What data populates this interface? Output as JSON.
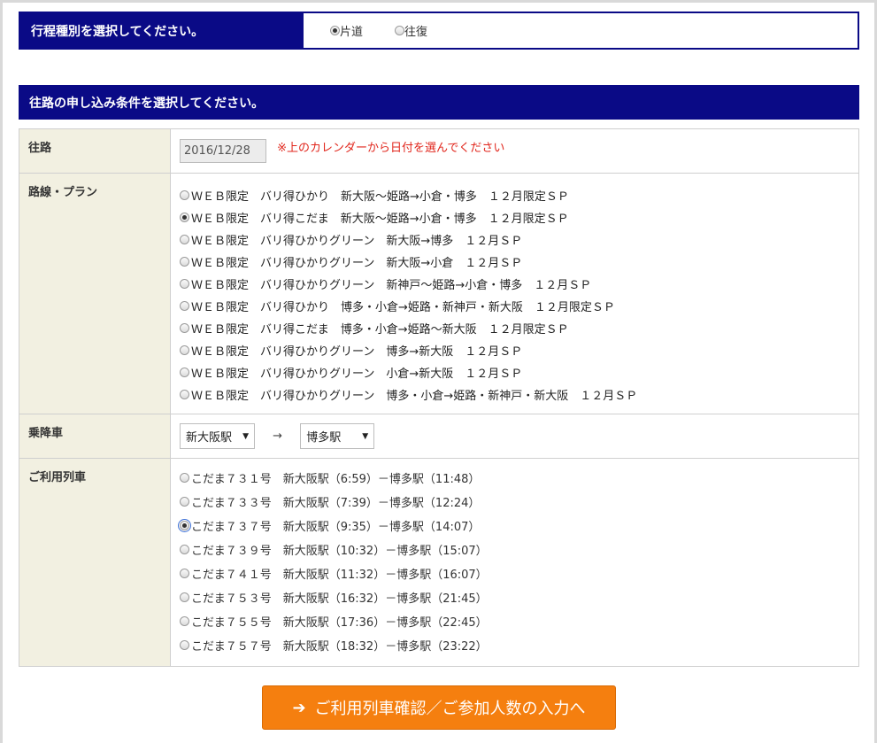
{
  "trip_type": {
    "label": "行程種別を選択してください。",
    "options": [
      {
        "label": "片道",
        "selected": true
      },
      {
        "label": "往復",
        "selected": false
      }
    ]
  },
  "outbound": {
    "header": "往路の申し込み条件を選択してください。",
    "date_label": "往路",
    "date_value": "2016/12/28",
    "date_note": "※上のカレンダーから日付を選んでください",
    "plan_label": "路線・プラン",
    "plans": [
      {
        "label": "ＷＥＢ限定　バリ得ひかり　新大阪～姫路→小倉・博多　１２月限定ＳＰ",
        "selected": false
      },
      {
        "label": "ＷＥＢ限定　バリ得こだま　新大阪～姫路→小倉・博多　１２月限定ＳＰ",
        "selected": true
      },
      {
        "label": "ＷＥＢ限定　バリ得ひかりグリーン　新大阪→博多　１２月ＳＰ",
        "selected": false
      },
      {
        "label": "ＷＥＢ限定　バリ得ひかりグリーン　新大阪→小倉　１２月ＳＰ",
        "selected": false
      },
      {
        "label": "ＷＥＢ限定　バリ得ひかりグリーン　新神戸～姫路→小倉・博多　１２月ＳＰ",
        "selected": false
      },
      {
        "label": "ＷＥＢ限定　バリ得ひかり　博多・小倉→姫路・新神戸・新大阪　１２月限定ＳＰ",
        "selected": false
      },
      {
        "label": "ＷＥＢ限定　バリ得こだま　博多・小倉→姫路～新大阪　１２月限定ＳＰ",
        "selected": false
      },
      {
        "label": "ＷＥＢ限定　バリ得ひかりグリーン　博多→新大阪　１２月ＳＰ",
        "selected": false
      },
      {
        "label": "ＷＥＢ限定　バリ得ひかりグリーン　小倉→新大阪　１２月ＳＰ",
        "selected": false
      },
      {
        "label": "ＷＥＢ限定　バリ得ひかりグリーン　博多・小倉→姫路・新神戸・新大阪　１２月ＳＰ",
        "selected": false
      }
    ],
    "station_label": "乗降車",
    "from_station": "新大阪駅",
    "arrow": "→",
    "to_station": "博多駅",
    "train_label": "ご利用列車",
    "trains": [
      {
        "label": "こだま７３１号　新大阪駅（6:59）－博多駅（11:48）",
        "selected": false
      },
      {
        "label": "こだま７３３号　新大阪駅（7:39）－博多駅（12:24）",
        "selected": false
      },
      {
        "label": "こだま７３７号　新大阪駅（9:35）－博多駅（14:07）",
        "selected": true
      },
      {
        "label": "こだま７３９号　新大阪駅（10:32）－博多駅（15:07）",
        "selected": false
      },
      {
        "label": "こだま７４１号　新大阪駅（11:32）－博多駅（16:07）",
        "selected": false
      },
      {
        "label": "こだま７５３号　新大阪駅（16:32）－博多駅（21:45）",
        "selected": false
      },
      {
        "label": "こだま７５５号　新大阪駅（17:36）－博多駅（22:45）",
        "selected": false
      },
      {
        "label": "こだま７５７号　新大阪駅（18:32）－博多駅（23:22）",
        "selected": false
      }
    ]
  },
  "submit": {
    "icon": "arrow-right-icon",
    "label": "ご利用列車確認／ご参加人数の入力へ"
  },
  "colors": {
    "header_bg": "#0a0a86",
    "label_bg": "#f2f0e1",
    "note_red": "#e1261c",
    "button_orange": "#f57f0f"
  }
}
